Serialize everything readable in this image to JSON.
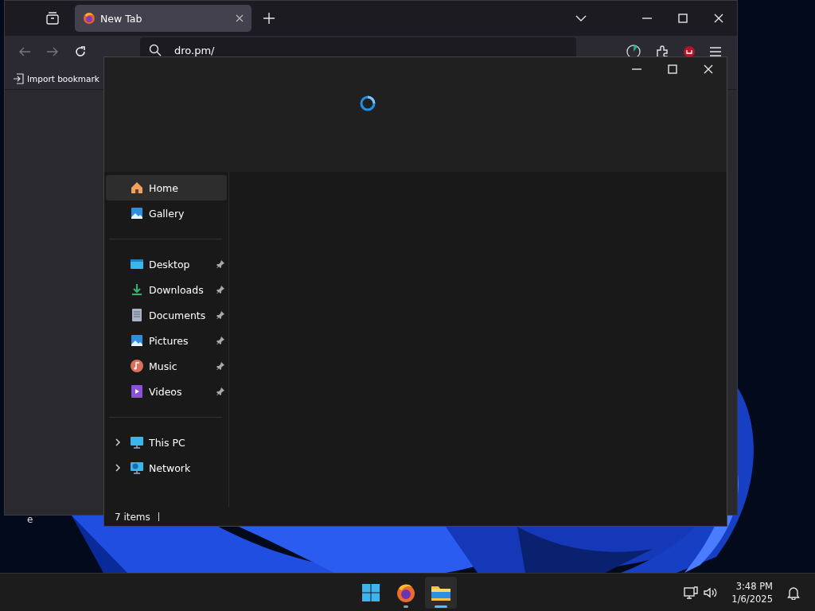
{
  "browser": {
    "tabs": [
      {
        "title": "New Tab",
        "selected": true
      }
    ],
    "address": {
      "value": "dro.pm/"
    },
    "bookmarks": [
      {
        "label": "Import bookmark"
      }
    ]
  },
  "desktop_label": "e",
  "explorer": {
    "sidebar": {
      "groups": [
        [
          {
            "label": "Home",
            "kind": "home",
            "selected": true,
            "pinned": false
          },
          {
            "label": "Gallery",
            "kind": "gallery",
            "selected": false,
            "pinned": false
          }
        ],
        [
          {
            "label": "Desktop",
            "kind": "desktop",
            "selected": false,
            "pinned": true
          },
          {
            "label": "Downloads",
            "kind": "downloads",
            "selected": false,
            "pinned": true
          },
          {
            "label": "Documents",
            "kind": "documents",
            "selected": false,
            "pinned": true
          },
          {
            "label": "Pictures",
            "kind": "pictures",
            "selected": false,
            "pinned": true
          },
          {
            "label": "Music",
            "kind": "music",
            "selected": false,
            "pinned": true
          },
          {
            "label": "Videos",
            "kind": "videos",
            "selected": false,
            "pinned": true
          }
        ],
        [
          {
            "label": "This PC",
            "kind": "pc",
            "selected": false,
            "pinned": false,
            "expanded": false
          },
          {
            "label": "Network",
            "kind": "network",
            "selected": false,
            "pinned": false,
            "expanded": false
          }
        ]
      ]
    },
    "status_bar": "7 items"
  },
  "taskbar": {
    "apps": [
      {
        "kind": "start",
        "running": false,
        "active": false
      },
      {
        "kind": "firefox",
        "running": true,
        "active": false
      },
      {
        "kind": "explorer",
        "running": true,
        "active": true
      }
    ],
    "time": "3:48 PM",
    "date": "1/6/2025"
  }
}
